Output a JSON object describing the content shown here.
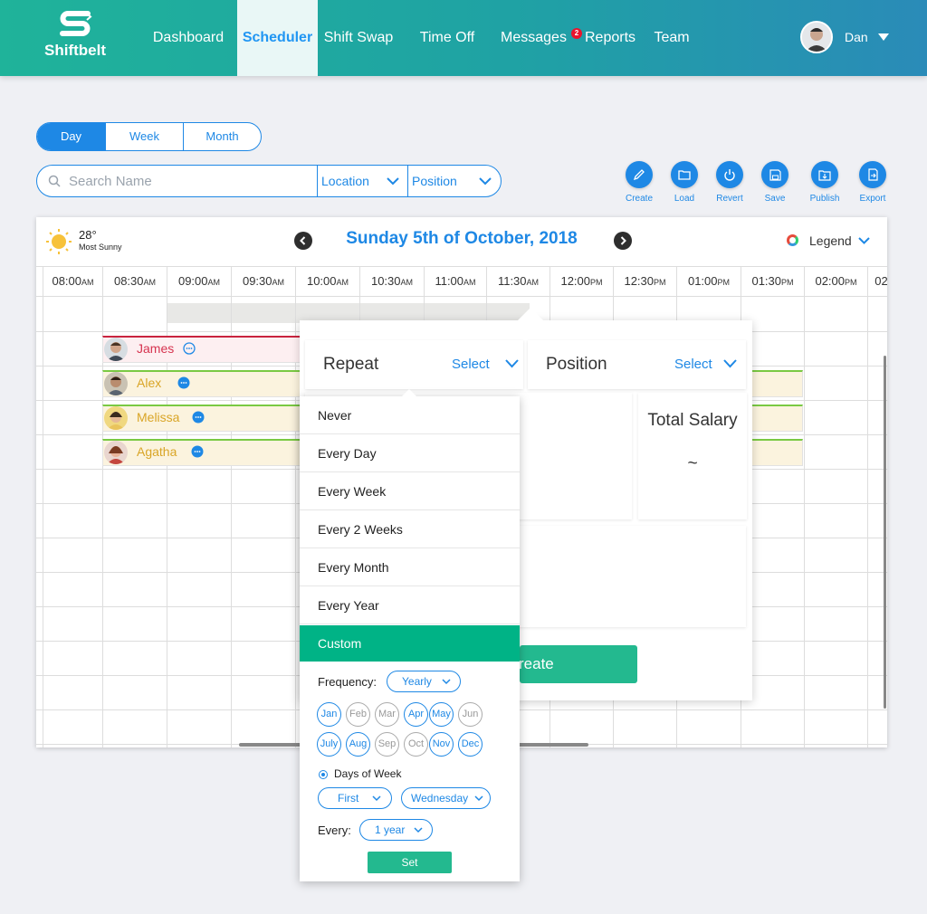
{
  "brand": {
    "name": "Shiftbelt"
  },
  "nav": {
    "items": [
      {
        "label": "Dashboard"
      },
      {
        "label": "Scheduler",
        "active": true
      },
      {
        "label": "Shift Swap"
      },
      {
        "label": "Time Off"
      },
      {
        "label": "Messages",
        "badge": "2"
      },
      {
        "label": "Reports"
      },
      {
        "label": "Team"
      }
    ]
  },
  "user": {
    "name": "Dan"
  },
  "view_toggle": {
    "options": [
      "Day",
      "Week",
      "Month"
    ],
    "selected": "Day"
  },
  "search": {
    "placeholder": "Search Name",
    "location_label": "Location",
    "position_label": "Position"
  },
  "toolbar": {
    "create": "Create",
    "load": "Load",
    "revert": "Revert",
    "save": "Save",
    "publish": "Publish",
    "export": "Export"
  },
  "weather": {
    "temp": "28°",
    "desc": "Most Sunny"
  },
  "schedule": {
    "date_title": "Sunday 5th of October, 2018",
    "legend_label": "Legend",
    "times": [
      {
        "t": "08:00",
        "p": "AM"
      },
      {
        "t": "08:30",
        "p": "AM"
      },
      {
        "t": "09:00",
        "p": "AM"
      },
      {
        "t": "09:30",
        "p": "AM"
      },
      {
        "t": "10:00",
        "p": "AM"
      },
      {
        "t": "10:30",
        "p": "AM"
      },
      {
        "t": "11:00",
        "p": "AM"
      },
      {
        "t": "11:30",
        "p": "AM"
      },
      {
        "t": "12:00",
        "p": "PM"
      },
      {
        "t": "12:30",
        "p": "PM"
      },
      {
        "t": "01:00",
        "p": "PM"
      },
      {
        "t": "01:30",
        "p": "PM"
      },
      {
        "t": "02:00",
        "p": "PM"
      },
      {
        "t": "02",
        "p": ""
      }
    ],
    "employees": [
      {
        "name": "James",
        "color": "#d6334f"
      },
      {
        "name": "Alex",
        "color": "#d9a526"
      },
      {
        "name": "Melissa",
        "color": "#d9a526"
      },
      {
        "name": "Agatha",
        "color": "#d9a526"
      }
    ]
  },
  "shift_popup": {
    "repeat_label": "Repeat",
    "repeat_value": "Select",
    "position_label": "Position",
    "position_value": "Select",
    "total_salary_label": "Total Salary",
    "total_salary_value": "~",
    "create_label": "reate"
  },
  "repeat_dropdown": {
    "options": [
      "Never",
      "Every Day",
      "Every Week",
      "Every 2 Weeks",
      "Every Month",
      "Every Year",
      "Custom"
    ],
    "selected": "Custom",
    "frequency_label": "Frequency:",
    "frequency_value": "Yearly",
    "months_row1": [
      {
        "m": "Jan",
        "on": true
      },
      {
        "m": "Feb",
        "on": false
      },
      {
        "m": "Mar",
        "on": false
      },
      {
        "m": "Apr",
        "on": true
      },
      {
        "m": "May",
        "on": true
      },
      {
        "m": "Jun",
        "on": false
      }
    ],
    "months_row2": [
      {
        "m": "July",
        "on": true
      },
      {
        "m": "Aug",
        "on": true
      },
      {
        "m": "Sep",
        "on": false
      },
      {
        "m": "Oct",
        "on": false
      },
      {
        "m": "Nov",
        "on": true
      },
      {
        "m": "Dec",
        "on": true
      }
    ],
    "days_of_week_label": "Days of Week",
    "ordinal_value": "First",
    "weekday_value": "Wednesday",
    "every_label": "Every:",
    "every_value": "1 year",
    "set_label": "Set"
  },
  "colors": {
    "accent": "#1e88e5",
    "brand_green": "#1fb39a",
    "custom_selected": "#00b386",
    "button_green": "#23b98f"
  }
}
